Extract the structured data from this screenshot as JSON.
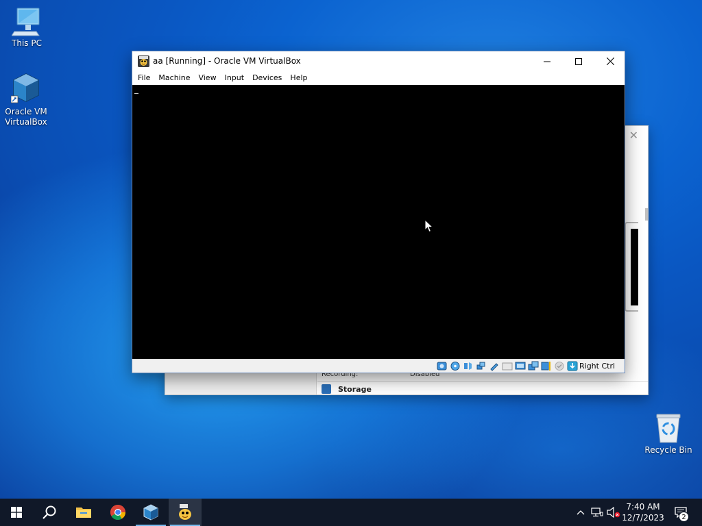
{
  "desktop": {
    "icons": [
      {
        "label": "This PC"
      },
      {
        "label": "Oracle VM VirtualBox"
      },
      {
        "label": "Recycle Bin"
      }
    ]
  },
  "background_window": {
    "rows": [
      {
        "label": "Recording:",
        "value": "Disabled"
      }
    ],
    "section": "Storage"
  },
  "vm_window": {
    "title": "aa [Running] - Oracle VM VirtualBox",
    "menu": [
      "File",
      "Machine",
      "View",
      "Input",
      "Devices",
      "Help"
    ],
    "status_host_key": "Right Ctrl",
    "status_icons": [
      "hard-disk-icon",
      "optical-drive-icon",
      "audio-icon",
      "network-icon",
      "usb-icon",
      "shared-folders-icon",
      "display-icon",
      "screen-capture-icon",
      "recording-icon",
      "cpu-icon",
      "mouse-integration-icon",
      "keyboard-capture-icon"
    ]
  },
  "taskbar": {
    "apps": [
      "start-icon",
      "search-icon",
      "file-explorer-icon",
      "chrome-icon",
      "virtualbox-manager-icon",
      "virtualbox-vm-icon"
    ],
    "time": "7:40 AM",
    "date": "12/7/2023",
    "notification_count": "2"
  },
  "colors": {
    "taskbar": "#101828",
    "accent": "#76b9ed",
    "desktop": "#0a63d0"
  }
}
